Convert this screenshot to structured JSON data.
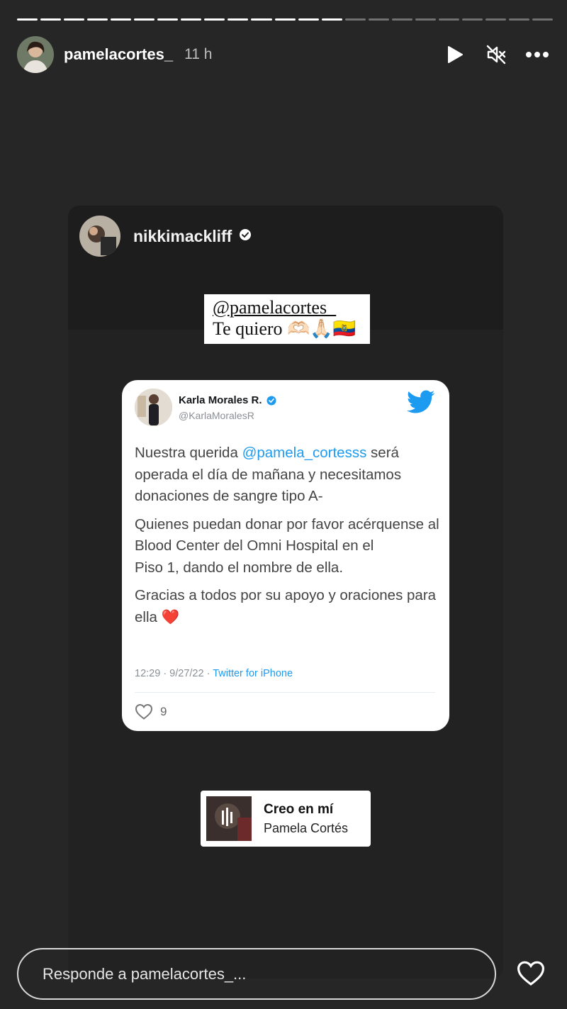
{
  "story": {
    "segments_total": 23,
    "segments_done": 14,
    "username": "pamelacortes_",
    "time": "11 h",
    "icons": [
      "play-icon",
      "muted-speaker-icon",
      "more-icon"
    ]
  },
  "post": {
    "author": "nikkimackliff",
    "author_verified": true,
    "caption_mention": "@pamelacortes_",
    "caption_text": "Te quiero 🫶🏻🙏🏻🇪🇨"
  },
  "tweet": {
    "name": "Karla Morales R.",
    "handle": "@KarlaMoralesR",
    "verified": true,
    "p1_before": "Nuestra querida ",
    "p1_mention": "@pamela_cortesss",
    "p1_after": " será operada el día de mañana y necesitamos donaciones de sangre tipo A-",
    "p2": "Quienes puedan donar por favor acérquense al Blood Center del Omni Hospital en el",
    "p2b": "Piso 1, dando el nombre de ella.",
    "p3": "Gracias a todos por su apoyo y oraciones para ella ❤️",
    "meta_time": "12:29 · 9/27/22 · ",
    "meta_source": "Twitter for iPhone",
    "likes": "9"
  },
  "music": {
    "title": "Creo en mí",
    "artist": "Pamela Cortés"
  },
  "reply": {
    "placeholder": "Responde a pamelacortes_..."
  }
}
